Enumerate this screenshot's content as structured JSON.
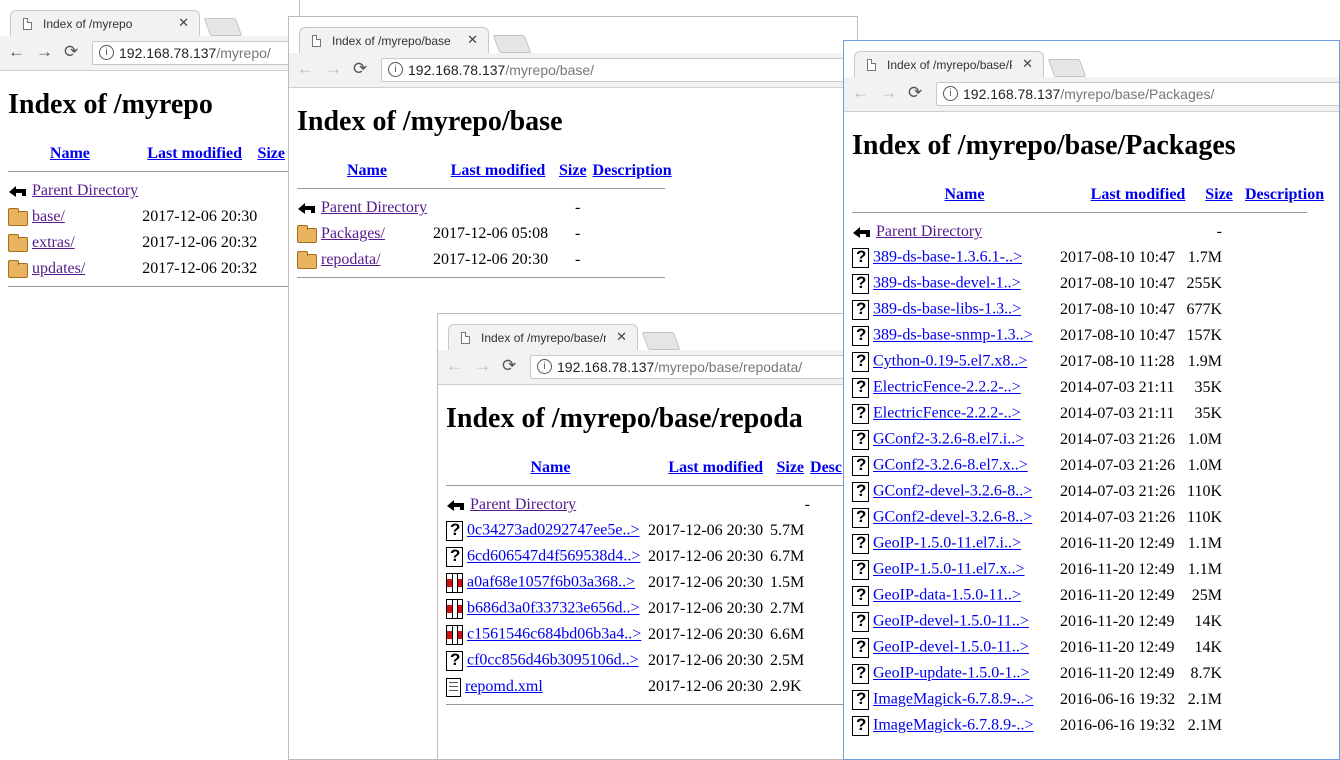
{
  "w1": {
    "tab_title": "Index of /myrepo",
    "url_host": "192.168.78.137",
    "url_path": "/myrepo/",
    "heading": "Index of /myrepo",
    "columns": {
      "name": "Name",
      "modified": "Last modified",
      "size": "Size"
    },
    "parent": "Parent Directory",
    "rows": [
      {
        "name": "base/",
        "date": "2017-12-06 20:30",
        "icon": "folder-icon"
      },
      {
        "name": "extras/",
        "date": "2017-12-06 20:32",
        "icon": "folder-icon"
      },
      {
        "name": "updates/",
        "date": "2017-12-06 20:32",
        "icon": "folder-icon"
      }
    ]
  },
  "w2": {
    "tab_title": "Index of /myrepo/base",
    "url_host": "192.168.78.137",
    "url_path": "/myrepo/base/",
    "heading": "Index of /myrepo/base",
    "columns": {
      "name": "Name",
      "modified": "Last modified",
      "size": "Size",
      "description": "Description"
    },
    "parent": "Parent Directory",
    "parent_size": "-",
    "rows": [
      {
        "name": "Packages/",
        "date": "2017-12-06 05:08",
        "size": "-",
        "icon": "folder-icon"
      },
      {
        "name": "repodata/",
        "date": "2017-12-06 20:30",
        "size": "-",
        "icon": "folder-icon"
      }
    ]
  },
  "w3": {
    "tab_title": "Index of /myrepo/base/r",
    "url_host": "192.168.78.137",
    "url_path": "/myrepo/base/repodata/",
    "heading": "Index of /myrepo/base/repoda",
    "columns": {
      "name": "Name",
      "modified": "Last modified",
      "size": "Size",
      "description": "Desc"
    },
    "parent": "Parent Directory",
    "parent_size": "-",
    "rows": [
      {
        "name": "0c34273ad0292747ee5e..>",
        "date": "2017-12-06 20:30",
        "size": "5.7M",
        "icon": "unknown-file-icon"
      },
      {
        "name": "6cd606547d4f569538d4..>",
        "date": "2017-12-06 20:30",
        "size": "6.7M",
        "icon": "unknown-file-icon"
      },
      {
        "name": "a0af68e1057f6b03a368..>",
        "date": "2017-12-06 20:30",
        "size": "1.5M",
        "icon": "compressed-file-icon"
      },
      {
        "name": "b686d3a0f337323e656d..>",
        "date": "2017-12-06 20:30",
        "size": "2.7M",
        "icon": "compressed-file-icon"
      },
      {
        "name": "c1561546c684bd06b3a4..>",
        "date": "2017-12-06 20:30",
        "size": "6.6M",
        "icon": "compressed-file-icon"
      },
      {
        "name": "cf0cc856d46b3095106d..>",
        "date": "2017-12-06 20:30",
        "size": "2.5M",
        "icon": "unknown-file-icon"
      },
      {
        "name": "repomd.xml",
        "date": "2017-12-06 20:30",
        "size": "2.9K",
        "icon": "text-file-icon"
      }
    ]
  },
  "w4": {
    "tab_title": "Index of /myrepo/base/P",
    "url_host": "192.168.78.137",
    "url_path": "/myrepo/base/Packages/",
    "heading": "Index of /myrepo/base/Packages",
    "columns": {
      "name": "Name",
      "modified": "Last modified",
      "size": "Size",
      "description": "Description"
    },
    "parent": "Parent Directory",
    "parent_size": "-",
    "rows": [
      {
        "name": "389-ds-base-1.3.6.1-..>",
        "date": "2017-08-10 10:47",
        "size": "1.7M",
        "icon": "unknown-file-icon"
      },
      {
        "name": "389-ds-base-devel-1..>",
        "date": "2017-08-10 10:47",
        "size": "255K",
        "icon": "unknown-file-icon"
      },
      {
        "name": "389-ds-base-libs-1.3..>",
        "date": "2017-08-10 10:47",
        "size": "677K",
        "icon": "unknown-file-icon"
      },
      {
        "name": "389-ds-base-snmp-1.3..>",
        "date": "2017-08-10 10:47",
        "size": "157K",
        "icon": "unknown-file-icon"
      },
      {
        "name": "Cython-0.19-5.el7.x8..>",
        "date": "2017-08-10 11:28",
        "size": "1.9M",
        "icon": "unknown-file-icon"
      },
      {
        "name": "ElectricFence-2.2.2-..>",
        "date": "2014-07-03 21:11",
        "size": "35K",
        "icon": "unknown-file-icon"
      },
      {
        "name": "ElectricFence-2.2.2-..>",
        "date": "2014-07-03 21:11",
        "size": "35K",
        "icon": "unknown-file-icon"
      },
      {
        "name": "GConf2-3.2.6-8.el7.i..>",
        "date": "2014-07-03 21:26",
        "size": "1.0M",
        "icon": "unknown-file-icon"
      },
      {
        "name": "GConf2-3.2.6-8.el7.x..>",
        "date": "2014-07-03 21:26",
        "size": "1.0M",
        "icon": "unknown-file-icon"
      },
      {
        "name": "GConf2-devel-3.2.6-8..>",
        "date": "2014-07-03 21:26",
        "size": "110K",
        "icon": "unknown-file-icon"
      },
      {
        "name": "GConf2-devel-3.2.6-8..>",
        "date": "2014-07-03 21:26",
        "size": "110K",
        "icon": "unknown-file-icon"
      },
      {
        "name": "GeoIP-1.5.0-11.el7.i..>",
        "date": "2016-11-20 12:49",
        "size": "1.1M",
        "icon": "unknown-file-icon"
      },
      {
        "name": "GeoIP-1.5.0-11.el7.x..>",
        "date": "2016-11-20 12:49",
        "size": "1.1M",
        "icon": "unknown-file-icon"
      },
      {
        "name": "GeoIP-data-1.5.0-11..>",
        "date": "2016-11-20 12:49",
        "size": "25M",
        "icon": "unknown-file-icon"
      },
      {
        "name": "GeoIP-devel-1.5.0-11..>",
        "date": "2016-11-20 12:49",
        "size": "14K",
        "icon": "unknown-file-icon"
      },
      {
        "name": "GeoIP-devel-1.5.0-11..>",
        "date": "2016-11-20 12:49",
        "size": "14K",
        "icon": "unknown-file-icon"
      },
      {
        "name": "GeoIP-update-1.5.0-1..>",
        "date": "2016-11-20 12:49",
        "size": "8.7K",
        "icon": "unknown-file-icon"
      },
      {
        "name": "ImageMagick-6.7.8.9-..>",
        "date": "2016-06-16 19:32",
        "size": "2.1M",
        "icon": "unknown-file-icon"
      },
      {
        "name": "ImageMagick-6.7.8.9-..>",
        "date": "2016-06-16 19:32",
        "size": "2.1M",
        "icon": "unknown-file-icon"
      }
    ]
  },
  "nav": {
    "back": "←",
    "forward": "→",
    "reload": "⟳",
    "close": "✕",
    "info": "i"
  }
}
